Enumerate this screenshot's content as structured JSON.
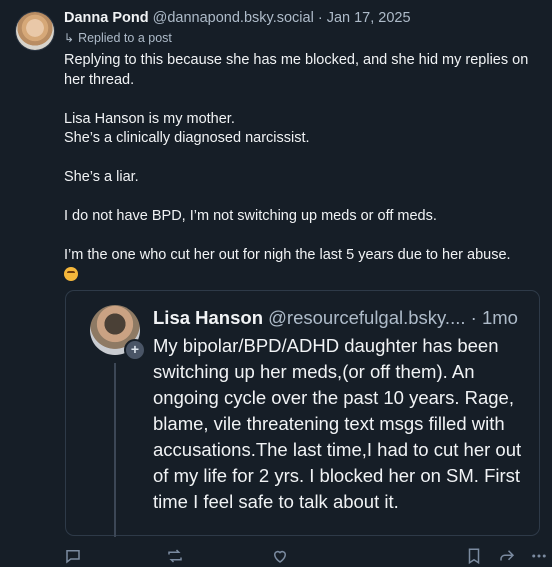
{
  "post": {
    "author_name": "Danna Pond",
    "author_handle": "@dannapond.bsky.social",
    "separator": "·",
    "date": "Jan 17, 2025",
    "reply_context": "Replied to a post",
    "body": {
      "p1": "Replying to this because she has me blocked, and she hid my replies on her thread.",
      "p2": "Lisa Hanson is my mother.",
      "p3": "She’s a clinically diagnosed narcissist.",
      "p4": "She’s a liar.",
      "p5": "I do not have BPD, I’m not switching up meds or off meds.",
      "p6": "I’m the one who cut her out for nigh the last 5 years due to her abuse."
    }
  },
  "quote": {
    "author_name": "Lisa Hanson",
    "author_handle": "@resourcefulgal.bsky....",
    "separator": "·",
    "time": "1mo",
    "add_icon": "+",
    "text": "My bipolar/BPD/ADHD daughter has been switching up her meds,(or off them). An ongoing cycle over the past 10 years. Rage, blame, vile threatening text msgs filled with accusations.The last time,I had to cut her out of my life for 2 yrs. I blocked her on SM. First time I feel safe to talk about it."
  },
  "icons": {
    "reply_context": "reply-arrow-icon",
    "emoji": "flushed-face-emoji",
    "actions": [
      "reply-icon",
      "repost-icon",
      "like-icon",
      "bookmark-icon",
      "share-icon",
      "more-icon"
    ]
  },
  "colors": {
    "background": "#161e27",
    "text": "#f1f3f5",
    "muted": "#aebbc9",
    "border": "#2e3a48",
    "icon": "#7b8ba0"
  }
}
